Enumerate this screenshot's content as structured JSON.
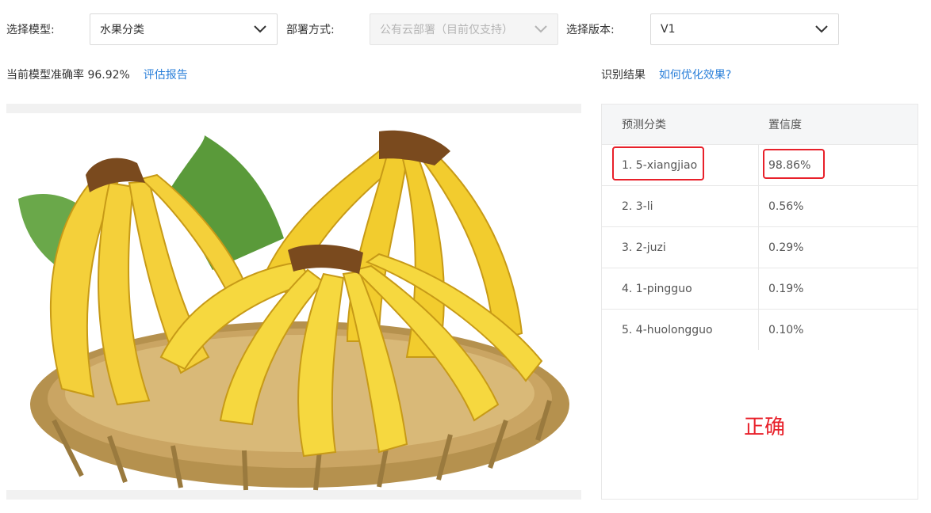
{
  "toolbar": {
    "model_label": "选择模型:",
    "model_value": "水果分类",
    "deploy_label": "部署方式:",
    "deploy_value": "公有云部署（目前仅支持）",
    "version_label": "选择版本:",
    "version_value": "V1"
  },
  "summary": {
    "accuracy_text": "当前模型准确率 96.92%",
    "eval_link": "评估报告"
  },
  "result": {
    "title": "识别结果",
    "optimize_link": "如何优化效果?",
    "col_class": "预测分类",
    "col_conf": "置信度",
    "rows": [
      {
        "cls": "1. 5-xiangjiao",
        "conf": "98.86%"
      },
      {
        "cls": "2. 3-li",
        "conf": "0.56%"
      },
      {
        "cls": "3. 2-juzi",
        "conf": "0.29%"
      },
      {
        "cls": "4. 1-pingguo",
        "conf": "0.19%"
      },
      {
        "cls": "5. 4-huolongguo",
        "conf": "0.10%"
      }
    ],
    "verdict": "正确"
  },
  "colors": {
    "accent_link": "#2a7fd9",
    "highlight": "#e8202a"
  },
  "image": {
    "subject": "bananas in woven basket"
  }
}
